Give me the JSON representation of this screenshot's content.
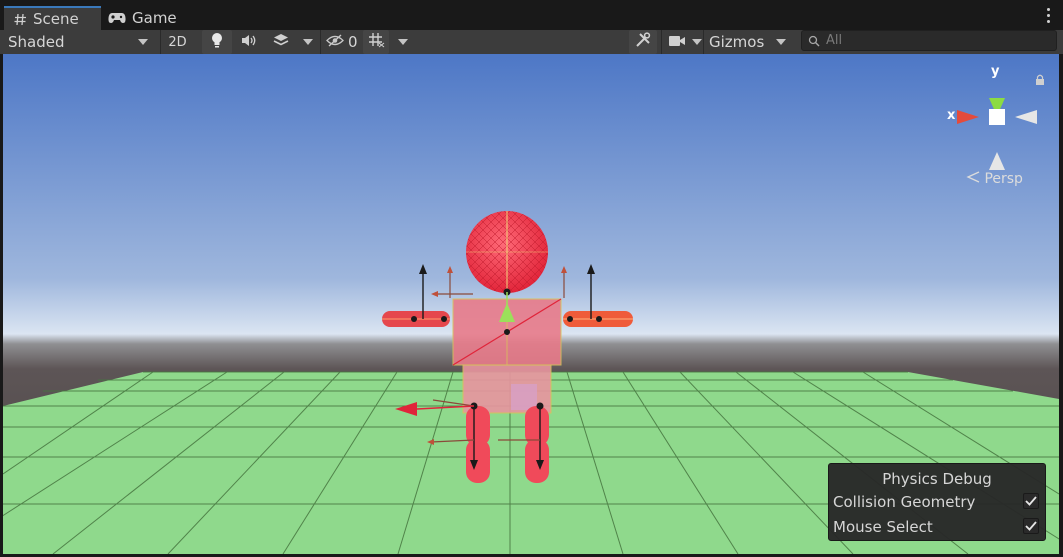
{
  "tabs": [
    {
      "label": "Scene",
      "icon": "hash-icon",
      "active": true
    },
    {
      "label": "Game",
      "icon": "gamepad-icon",
      "active": false
    }
  ],
  "toolbar": {
    "draw_mode": "Shaded",
    "mode_2d_label": "2D",
    "hidden_count": "0",
    "gizmos_label": "Gizmos"
  },
  "search": {
    "placeholder": "All",
    "value": ""
  },
  "scene_gizmo": {
    "x_label": "x",
    "y_label": "y",
    "projection_label": "Persp"
  },
  "physics_debug": {
    "title": "Physics Debug",
    "options": [
      {
        "label": "Collision Geometry",
        "checked": true
      },
      {
        "label": "Mouse Select",
        "checked": true
      }
    ]
  },
  "colors": {
    "sky_top": "#4d77c6",
    "sky_horizon": "#dbe5f2",
    "ground": "#8fd98c",
    "ground_grid": "#46753f",
    "collider": "#f23448",
    "axis_x": "#e44b3b",
    "axis_y": "#8cdc42",
    "accent_tab": "#3a79bb"
  }
}
